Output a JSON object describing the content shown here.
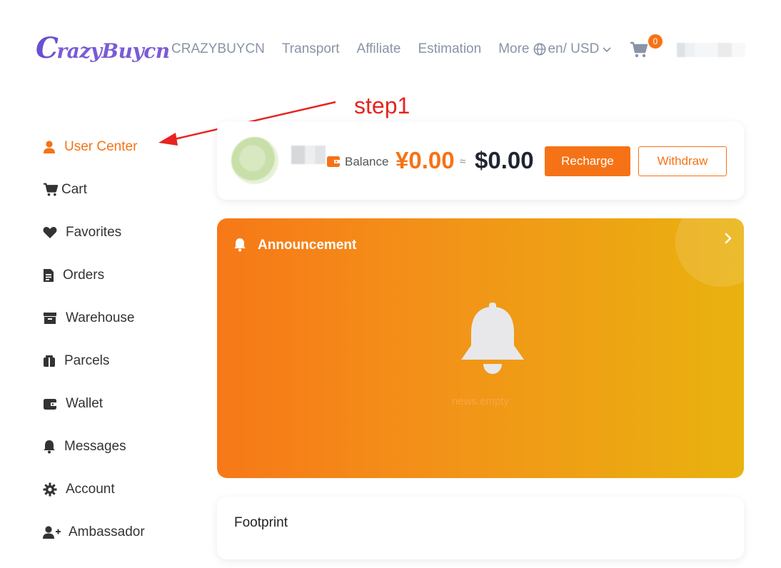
{
  "header": {
    "logo_text": "CrazyBuycn",
    "nav": [
      {
        "label": "CRAZYBUYCN"
      },
      {
        "label": "Transport"
      },
      {
        "label": "Affiliate"
      },
      {
        "label": "Estimation"
      },
      {
        "label": "More"
      }
    ],
    "language_currency": "en/ USD",
    "cart_count": "0"
  },
  "annotation": {
    "step_label": "step1"
  },
  "sidebar": {
    "items": [
      {
        "label": "User Center",
        "icon": "user-icon",
        "active": true
      },
      {
        "label": "Cart",
        "icon": "cart-icon"
      },
      {
        "label": "Favorites",
        "icon": "heart-icon"
      },
      {
        "label": "Orders",
        "icon": "document-icon"
      },
      {
        "label": "Warehouse",
        "icon": "archive-box-icon"
      },
      {
        "label": "Parcels",
        "icon": "gift-box-icon"
      },
      {
        "label": "Wallet",
        "icon": "wallet-icon"
      },
      {
        "label": "Messages",
        "icon": "bell-icon"
      },
      {
        "label": "Account",
        "icon": "gear-icon"
      },
      {
        "label": "Ambassador",
        "icon": "user-plus-icon"
      }
    ]
  },
  "balance": {
    "label": "Balance",
    "cny": "¥0.00",
    "approx": "≈",
    "usd": "$0.00",
    "recharge_label": "Recharge",
    "withdraw_label": "Withdraw"
  },
  "announcement": {
    "title": "Announcement",
    "empty_text": "news.empty"
  },
  "footprint": {
    "title": "Footprint"
  },
  "colors": {
    "accent": "#f57316",
    "annotation": "#e8231f"
  }
}
